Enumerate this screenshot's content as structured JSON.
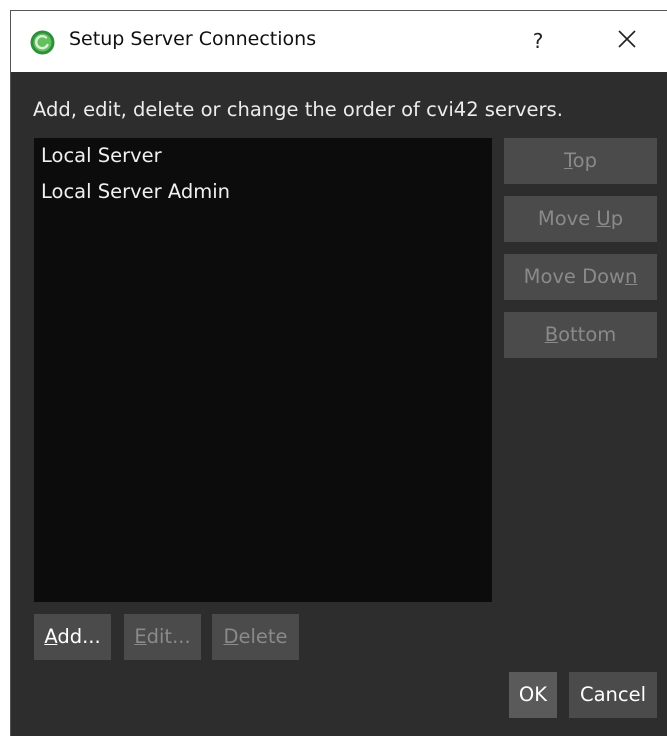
{
  "dialog": {
    "title": "Setup Server Connections",
    "help_label": "?",
    "icons": {
      "app": "cvi42-app-icon",
      "close": "close-icon"
    }
  },
  "instruction": "Add, edit, delete or change the order of cvi42 servers.",
  "servers": [
    {
      "name": "Local Server"
    },
    {
      "name": "Local Server Admin"
    }
  ],
  "order_buttons": {
    "top": {
      "pre": "",
      "mnemonic": "T",
      "post": "op",
      "enabled": false
    },
    "move_up": {
      "pre": "Move ",
      "mnemonic": "U",
      "post": "p",
      "enabled": false
    },
    "move_down": {
      "pre": "Move Dow",
      "mnemonic": "n",
      "post": "",
      "enabled": false
    },
    "bottom": {
      "pre": "",
      "mnemonic": "B",
      "post": "ottom",
      "enabled": false
    }
  },
  "list_buttons": {
    "add": {
      "pre": "",
      "mnemonic": "A",
      "post": "dd...",
      "enabled": true
    },
    "edit": {
      "pre": "",
      "mnemonic": "E",
      "post": "dit...",
      "enabled": false
    },
    "delete": {
      "pre": "",
      "mnemonic": "D",
      "post": "elete",
      "enabled": false
    }
  },
  "dialog_buttons": {
    "ok": "OK",
    "cancel": "Cancel"
  },
  "colors": {
    "background": "#2d2d2d",
    "list_background": "#0c0c0c",
    "button": "#4b4b4b",
    "disabled_text": "#8a8a8a",
    "app_icon_green": "#3fa34d"
  }
}
